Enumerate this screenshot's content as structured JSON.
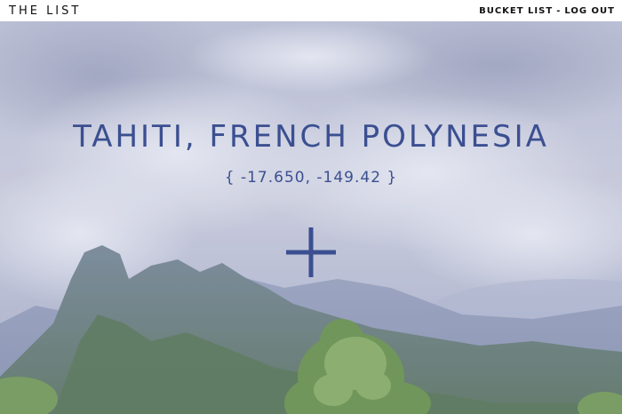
{
  "header": {
    "brand": "THE LIST",
    "nav": {
      "bucket_list": "BUCKET LIST",
      "separator": "-",
      "log_out": "LOG OUT"
    }
  },
  "hero": {
    "location_name": "TAHITI, FRENCH POLYNESIA",
    "coordinates": "{ -17.650, -149.42 }",
    "add_icon": "plus-icon"
  },
  "colors": {
    "accent": "#3b4f91",
    "header_bg": "#ffffff",
    "header_text": "#111111"
  }
}
